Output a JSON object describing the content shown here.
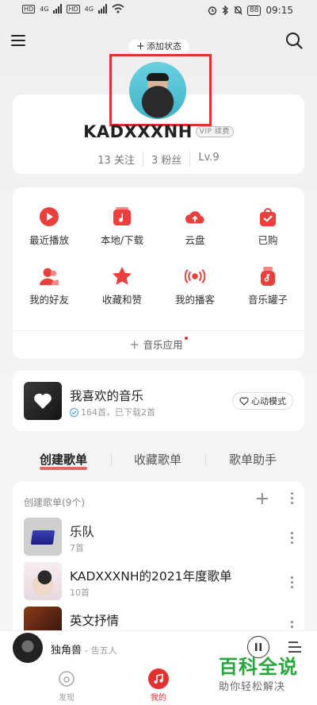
{
  "status_bar": {
    "left_badges": [
      "HD",
      "4G",
      "HD",
      "4G"
    ],
    "battery": "88",
    "time": "09:15"
  },
  "header": {
    "add_status_label": "添加状态",
    "menu_icon": "hamburger-menu-icon",
    "search_icon": "search-icon"
  },
  "profile": {
    "nickname": "KADXXXNH",
    "vip_badge": "VIP 续费",
    "stats": [
      "13 关注",
      "3 粉丝",
      "Lv.9"
    ]
  },
  "grid": {
    "items": [
      {
        "label": "最近播放",
        "icon": "play-circle-icon"
      },
      {
        "label": "本地/下载",
        "icon": "local-music-icon"
      },
      {
        "label": "云盘",
        "icon": "cloud-upload-icon"
      },
      {
        "label": "已购",
        "icon": "purchased-bag-icon"
      },
      {
        "label": "我的好友",
        "icon": "friends-icon"
      },
      {
        "label": "收藏和赞",
        "icon": "star-icon"
      },
      {
        "label": "我的播客",
        "icon": "podcast-icon"
      },
      {
        "label": "音乐罐子",
        "icon": "music-jar-icon"
      }
    ],
    "add_app_label": "音乐应用"
  },
  "favorite": {
    "title": "我喜欢的音乐",
    "subtitle": "164首，已下载2首",
    "heart_mode_label": "心动模式"
  },
  "tabs": [
    {
      "label": "创建歌单",
      "active": true
    },
    {
      "label": "收藏歌单",
      "active": false
    },
    {
      "label": "歌单助手",
      "active": false
    }
  ],
  "playlists": {
    "header": "创建歌单(9个)",
    "items": [
      {
        "name": "乐队",
        "count": "7首"
      },
      {
        "name": "KADXXXNH的2021年度歌单",
        "count": "10首"
      },
      {
        "name": "英文抒情",
        "count": ""
      }
    ]
  },
  "mini_player": {
    "song": "独角兽",
    "artist": "- 告五人"
  },
  "bottom_nav": [
    {
      "label": "发现",
      "active": false
    },
    {
      "label": "我的",
      "active": true
    }
  ],
  "watermark": {
    "main": "百科全说",
    "sub": "助你轻松解决"
  },
  "colors": {
    "accent": "#e0322f",
    "watermark_green": "#2aa63f"
  }
}
